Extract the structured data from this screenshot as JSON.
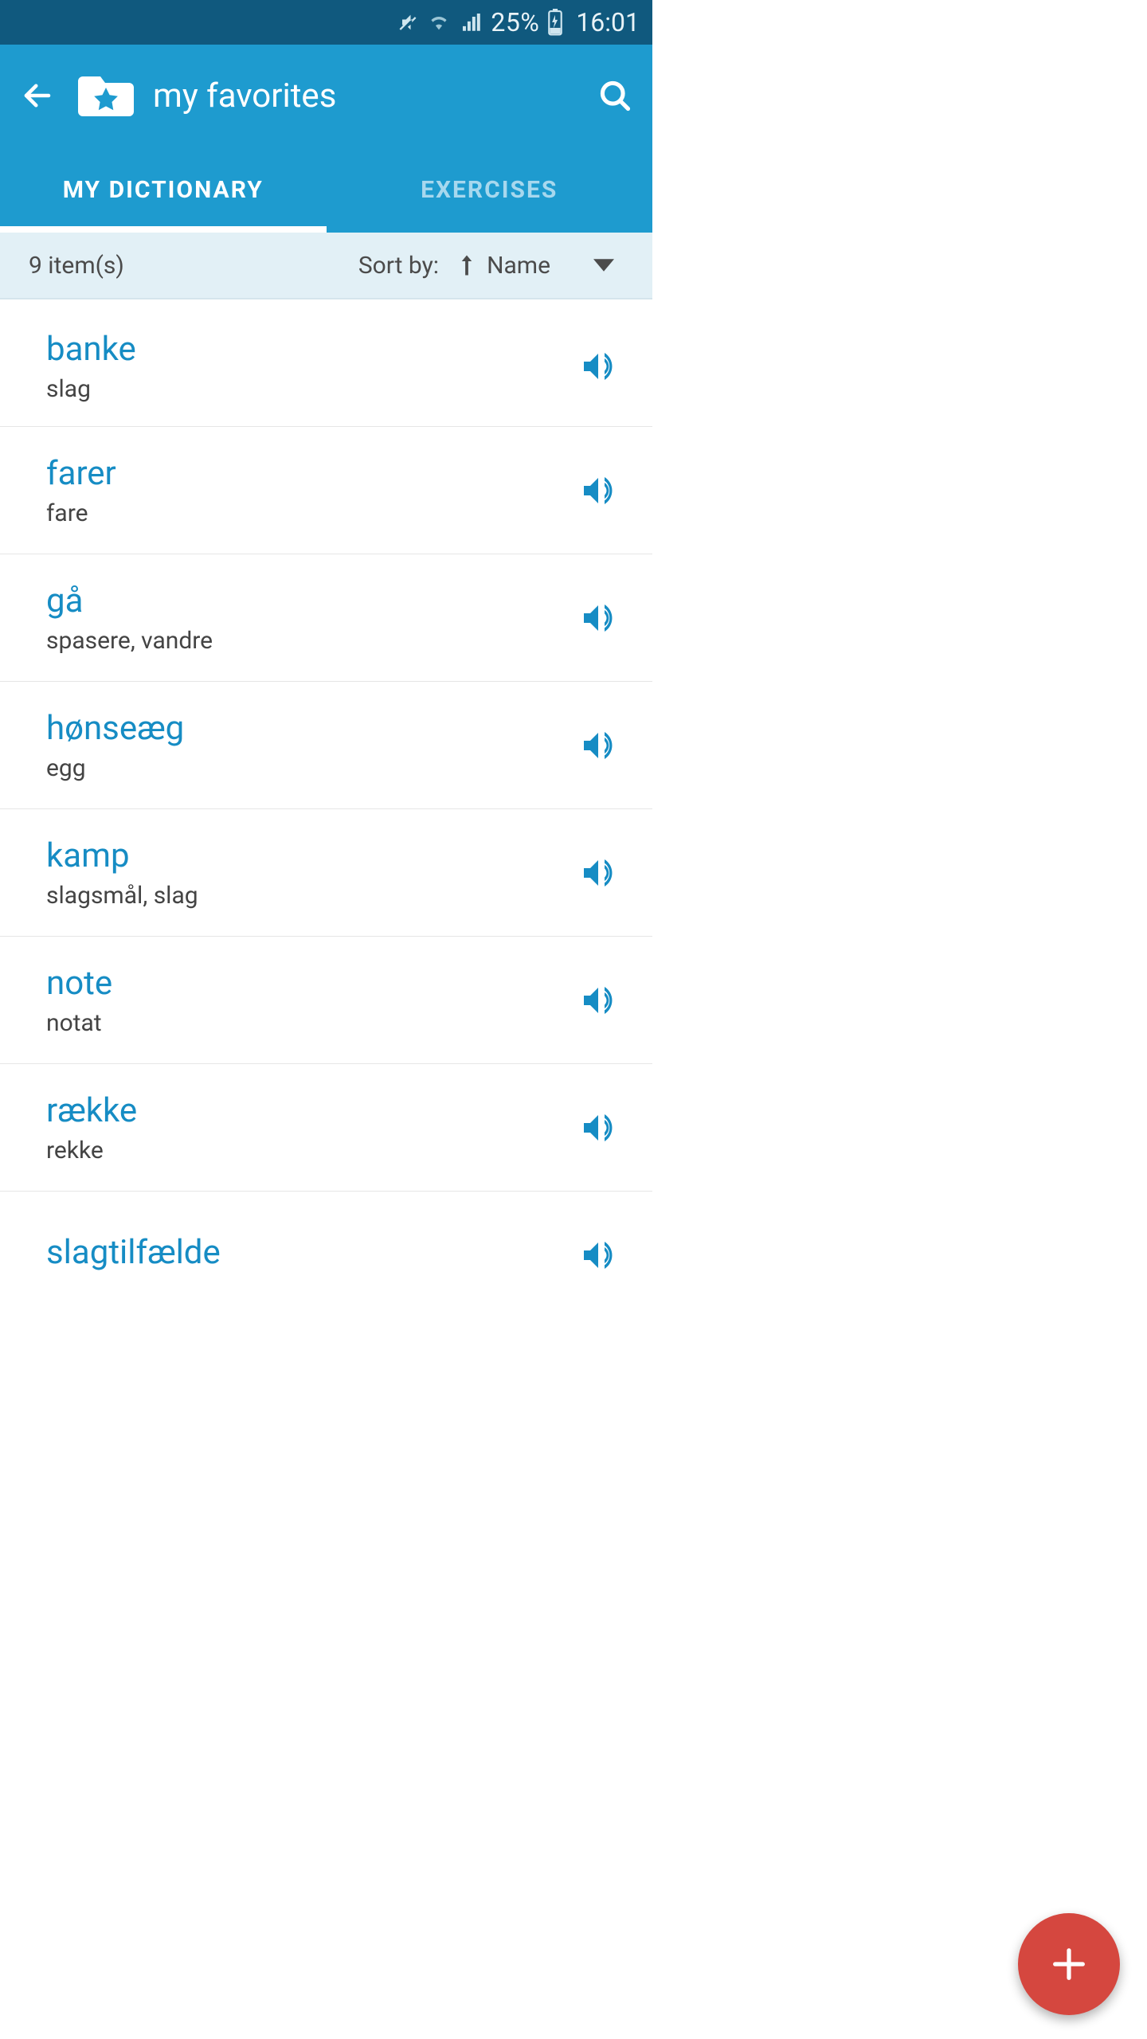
{
  "status": {
    "battery_pct": "25%",
    "time": "16:01"
  },
  "header": {
    "title": "my favorites"
  },
  "tabs": [
    {
      "label": "MY DICTIONARY",
      "active": true
    },
    {
      "label": "EXERCISES",
      "active": false
    }
  ],
  "sortbar": {
    "count_text": "9 item(s)",
    "sortby_label": "Sort by:",
    "sort_field": "Name"
  },
  "words": [
    {
      "word": "banke",
      "translation": "slag"
    },
    {
      "word": "farer",
      "translation": "fare"
    },
    {
      "word": "gå",
      "translation": "spasere, vandre"
    },
    {
      "word": "hønseæg",
      "translation": "egg"
    },
    {
      "word": "kamp",
      "translation": "slagsmål, slag"
    },
    {
      "word": "note",
      "translation": "notat"
    },
    {
      "word": "række",
      "translation": "rekke"
    },
    {
      "word": "slagtilfælde",
      "translation": ""
    }
  ],
  "colors": {
    "statusbar": "#10597e",
    "header": "#1e9bcf",
    "accent": "#168cc4",
    "fab": "#d5473f",
    "sortbar": "#e2f0f6"
  }
}
